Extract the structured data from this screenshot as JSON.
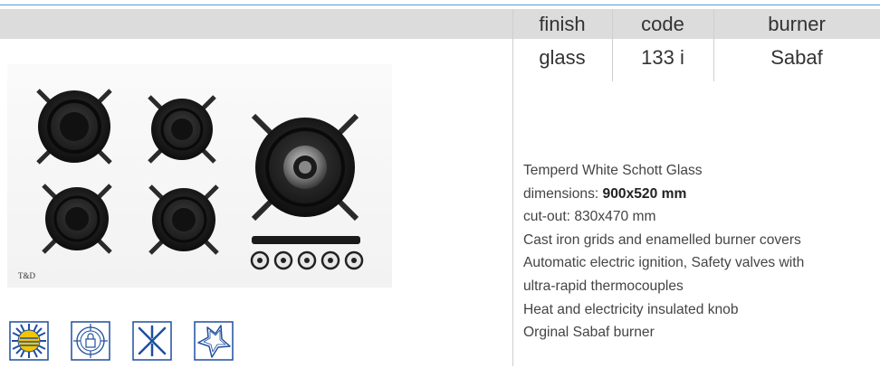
{
  "table": {
    "headers": [
      "finish",
      "code",
      "burner"
    ],
    "values": [
      "glass",
      "133 i",
      "Sabaf"
    ]
  },
  "product_image": {
    "brand_label": "T&D"
  },
  "specs": {
    "line1": "Temperd White Schott Glass",
    "dimensions_label": "dimensions: ",
    "dimensions_value": "900x520 mm",
    "line3": "cut-out: 830x470 mm",
    "line4": "Cast iron grids and enamelled burner covers",
    "line5": "Automatic electric ignition, Safety valves with",
    "line6": "ultra-rapid thermocouples",
    "line7": "Heat and electricity insulated knob",
    "line8": "Orginal Sabaf burner"
  },
  "feature_icons": [
    "sun-icon",
    "target-lock-icon",
    "snowflake-icon",
    "star-icon"
  ],
  "colors": {
    "accent_line": "#5b9bd0",
    "header_bar": "#dcdcdc",
    "icon_blue": "#1f4fa0",
    "icon_yellow": "#f2c500"
  }
}
